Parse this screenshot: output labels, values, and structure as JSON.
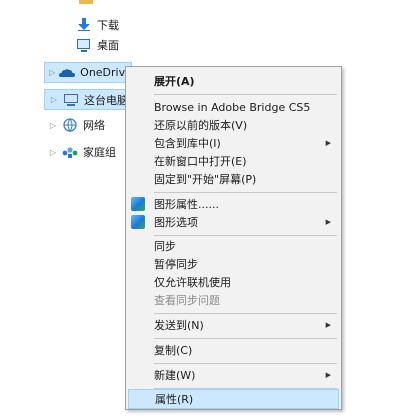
{
  "tree": {
    "partial_label": "",
    "downloads": "下载",
    "desktop": "桌面",
    "onedrive": "OneDrive",
    "this_pc": "这台电脑",
    "network": "网络",
    "homegroup": "家庭组"
  },
  "context_menu": {
    "expand": "展开(A)",
    "browse_bridge": "Browse in Adobe Bridge CS5",
    "restore_previous": "还原以前的版本(V)",
    "include_in_library": "包含到库中(I)",
    "open_new_window": "在新窗口中打开(E)",
    "pin_to_start": "固定到\"开始\"屏幕(P)",
    "graphics_properties": "图形属性......",
    "graphics_options": "图形选项",
    "sync": "同步",
    "pause_sync": "暂停同步",
    "offline_only": "仅允许联机使用",
    "view_sync_issues": "查看同步问题",
    "send_to": "发送到(N)",
    "copy": "复制(C)",
    "new": "新建(W)",
    "properties": "属性(R)"
  },
  "colors": {
    "selection_bg": "#cce8ff",
    "selection_border": "#99d1ff",
    "menu_bg": "#f2f2f2",
    "disabled_text": "#8d8d8d"
  }
}
